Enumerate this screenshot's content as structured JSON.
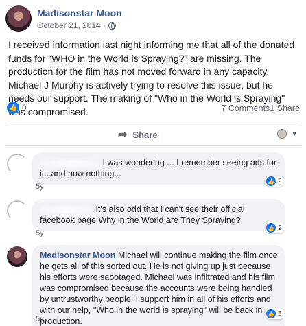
{
  "post": {
    "author": "Madisonstar Moon",
    "date": "October 21, 2014 ·",
    "privacy_icon": "globe-icon",
    "text": "I received information last night informing me that all of the donated funds for “WHO in the World is Spraying?” are missing. The production for the film has not moved forward in any capacity. Michael J Murphy is actively trying to resolve this issue, but he needs our support. The making of \"Who in the World is Spraying\" was compromised.",
    "reaction_count": "9",
    "comments_count": "7 Comments",
    "shares_count": "1 Share"
  },
  "actions": {
    "share_label": "Share"
  },
  "comments": [
    {
      "author": "",
      "text": "I was wondering ... I remember seeing ads for it...and now nothing...",
      "time": "5y",
      "reactions": "2"
    },
    {
      "author": "",
      "text": "It's also odd that I can't see their official facebook page Why in the World are They Spraying?",
      "time": "5y",
      "reactions": "2"
    },
    {
      "author": "Madisonstar Moon",
      "text": "Michael will continue making the film once he gets all of this sorted out. He is not giving up just because his efforts were sabotaged. Michael was infiltrated and his film was compromised because the accounts were being handled by untrustworthy people. I support him in all of his efforts and with our help, \"Who in the world is spraying\" will be back in production.",
      "time": "5y",
      "reactions": "5"
    }
  ],
  "colors": {
    "link_blue": "#385898",
    "like_blue": "#1877f2",
    "bubble_bg": "#f0f2f5",
    "meta_gray": "#606770"
  }
}
